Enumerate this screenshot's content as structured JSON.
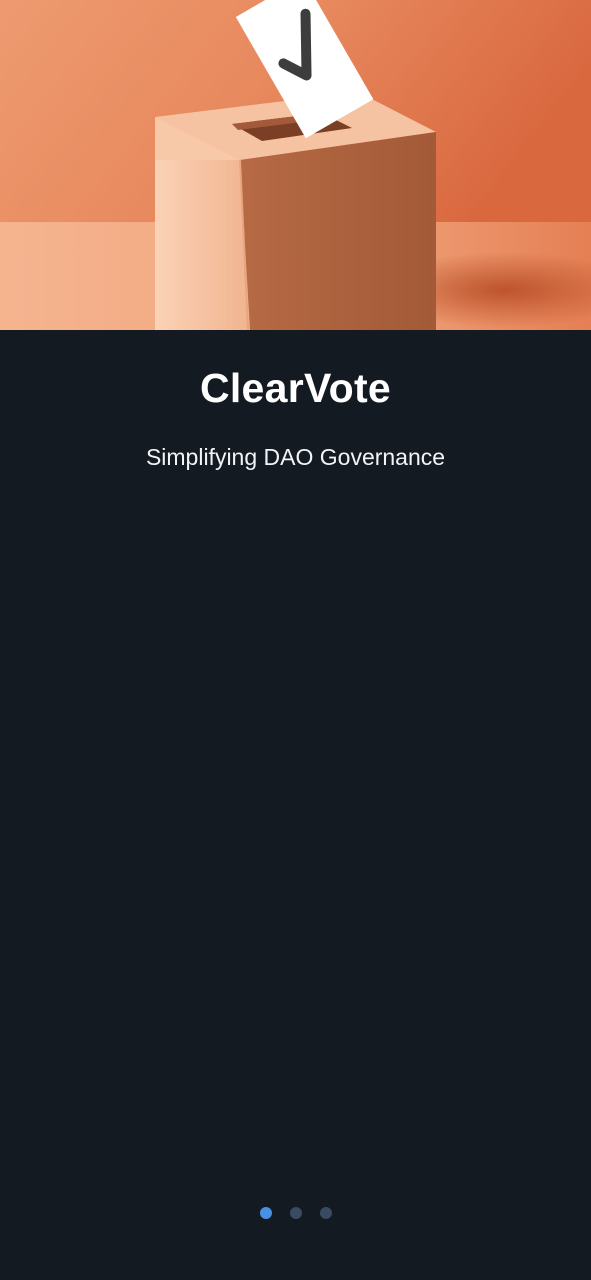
{
  "app": {
    "title": "ClearVote",
    "tagline": "Simplifying DAO Governance"
  },
  "hero": {
    "image_subject": "ballot-box-with-checkmark-ballot",
    "colors": {
      "background": "#ea8a5e",
      "box": "#f3b893",
      "ballot": "#ffffff",
      "checkmark": "#3d3d3d"
    }
  },
  "pager": {
    "total": 3,
    "active_index": 0,
    "active_color": "#4a90e2",
    "inactive_color": "#3a4b61"
  },
  "theme": {
    "background": "#141a22",
    "text": "#ffffff"
  }
}
